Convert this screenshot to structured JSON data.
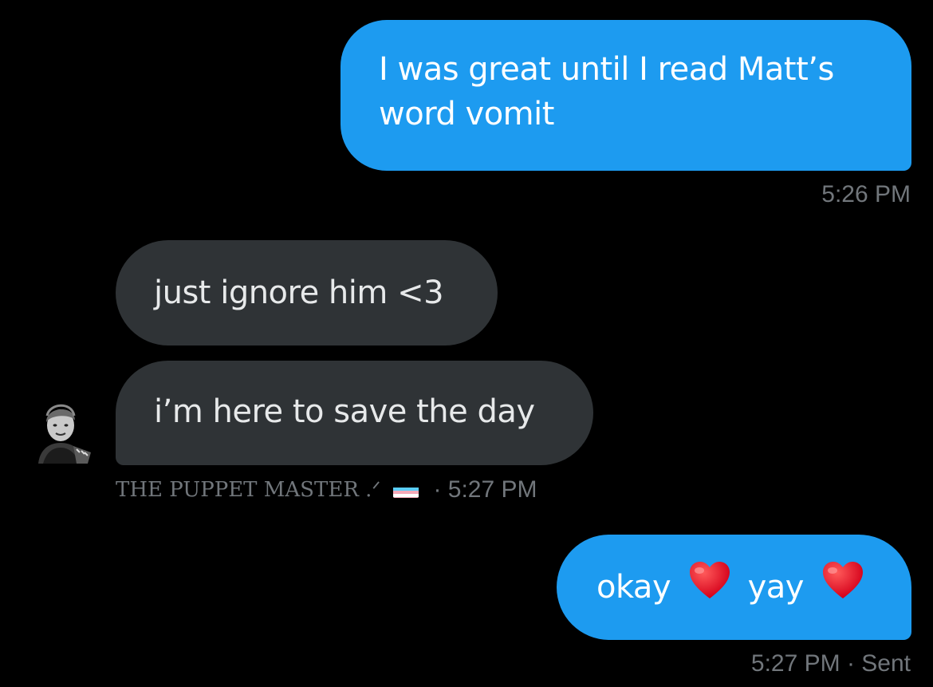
{
  "messages": [
    {
      "direction": "sent",
      "text": "I was great until I read Matt’s word vomit",
      "time": "5:26 PM"
    },
    {
      "direction": "received",
      "text": "just ignore him <3"
    },
    {
      "direction": "received",
      "text": "i’m here to save the day",
      "sender": "THE PUPPET MASTER .ᐟ",
      "sender_flag_icon": "transgender-flag-icon",
      "meta": "· 5:27 PM"
    },
    {
      "direction": "sent",
      "text_parts": [
        "okay",
        "yay"
      ],
      "emoji_icon": "red-heart-icon",
      "meta": "5:27 PM · Sent"
    }
  ],
  "colors": {
    "background": "#000000",
    "sent_bubble": "#1d9bf0",
    "received_bubble": "#2f3336",
    "meta_text": "#71767b"
  }
}
